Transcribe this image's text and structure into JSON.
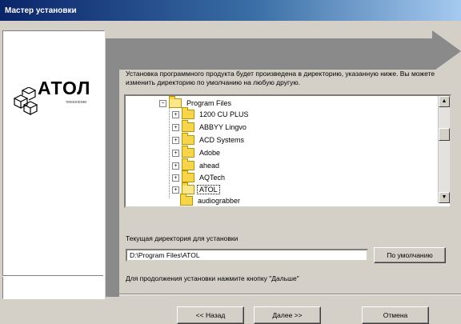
{
  "window": {
    "title": "Мастер установки"
  },
  "logo": {
    "brand": "АТОЛ",
    "subtitle": "технологии"
  },
  "main": {
    "description": "Установка программного продукта будет произведена в директорию, указанную ниже. Вы можете изменить директорию по умолчанию на любую другую.",
    "tree": {
      "root": "Program Files",
      "items": [
        {
          "label": "1200 CU PLUS",
          "expandable": true
        },
        {
          "label": "ABBYY Lingvo",
          "expandable": true
        },
        {
          "label": "ACD Systems",
          "expandable": true
        },
        {
          "label": "Adobe",
          "expandable": true
        },
        {
          "label": "ahead",
          "expandable": true
        },
        {
          "label": "AQTech",
          "expandable": true
        },
        {
          "label": "ATOL",
          "expandable": true,
          "selected": true
        },
        {
          "label": "audiograbber",
          "expandable": false
        }
      ]
    },
    "current_dir_label": "Текущая директория для установки",
    "current_dir_value": "D:\\Program Files\\ATOL",
    "default_button": "По умолчанию",
    "hint": "Для продолжения установки нажмите кнопку \"Дальше\""
  },
  "footer": {
    "back_button": "<< Назад",
    "next_button": "Далее >>",
    "cancel_button": "Отмена"
  }
}
